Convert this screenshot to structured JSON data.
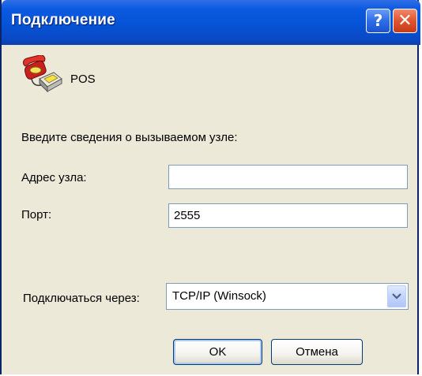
{
  "window": {
    "title": "Подключение",
    "help_glyph": "?",
    "close_glyph": "✕"
  },
  "connection": {
    "name": "POS",
    "icon": "phone-connection-icon"
  },
  "form": {
    "prompt": "Введите сведения о вызываемом узле:",
    "address_label": "Адрес узла:",
    "address_value": "",
    "port_label": "Порт:",
    "port_value": "2555",
    "connect_via_label": "Подключаться через:",
    "connect_via_value": "TCP/IP (Winsock)"
  },
  "buttons": {
    "ok": "OK",
    "cancel": "Отмена"
  },
  "colors": {
    "titlebar": "#0553d6",
    "close_button": "#e0542f",
    "dialog_background": "#ece9d8"
  }
}
